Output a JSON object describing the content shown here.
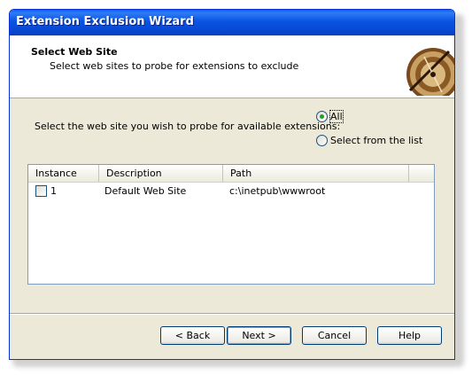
{
  "window": {
    "title": "Extension Exclusion Wizard"
  },
  "header": {
    "title": "Select Web Site",
    "subtitle": "Select web sites to probe for extensions to exclude"
  },
  "prompt": "Select the web site you wish to probe for available extensions:",
  "options": {
    "all": {
      "label": "All",
      "selected": true
    },
    "list": {
      "label": "Select from the list",
      "selected": false
    }
  },
  "table": {
    "columns": [
      "Instance",
      "Description",
      "Path"
    ],
    "rows": [
      {
        "instance": "1",
        "description": "Default Web Site",
        "path": "c:\\inetpub\\wwwroot",
        "checked": false
      }
    ]
  },
  "buttons": {
    "back": "< Back",
    "next": "Next >",
    "cancel": "Cancel",
    "help": "Help"
  },
  "colors": {
    "titlebar": "#0a5fe9",
    "dialog_bg": "#ece9d8",
    "accent_radio": "#21a121"
  }
}
